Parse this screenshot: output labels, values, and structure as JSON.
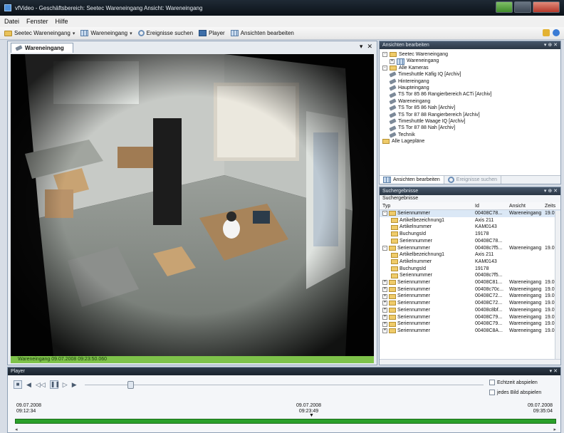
{
  "window": {
    "title": "vfVideo - Geschäftsbereich: Seetec Wareneingang Ansicht: Wareneingang"
  },
  "menu": [
    "Datei",
    "Fenster",
    "Hilfe"
  ],
  "toolbar": {
    "items": [
      {
        "label": "Seetec Wareneingang",
        "icon": "folder-icon"
      },
      {
        "label": "Wareneingang",
        "icon": "layout-grid-icon"
      },
      {
        "label": "Ereignisse suchen",
        "icon": "search-icon"
      },
      {
        "label": "Player",
        "icon": "player-icon"
      },
      {
        "label": "Ansichten bearbeiten",
        "icon": "layout-grid-icon"
      }
    ]
  },
  "document": {
    "tab": "Wareneingang",
    "status": "Wareneingang  09.07.2008 09:23:50.060"
  },
  "views_panel": {
    "title": "Ansichten bearbeiten",
    "tree": [
      {
        "level": 0,
        "expander": "-",
        "icon": "folder-icon",
        "label": "Seetec Wareneingang"
      },
      {
        "level": 1,
        "expander": "+",
        "icon": "layout-grid-icon",
        "label": "Wareneingang"
      },
      {
        "level": 0,
        "expander": "-",
        "icon": "folder-icon",
        "label": "Alle Kameras"
      },
      {
        "level": 1,
        "expander": "",
        "icon": "camera-icon",
        "label": "Timeshuttle Käfig IQ [Archiv]"
      },
      {
        "level": 1,
        "expander": "",
        "icon": "camera-icon",
        "label": "Hintereingang"
      },
      {
        "level": 1,
        "expander": "",
        "icon": "camera-icon",
        "label": "Haupteingang"
      },
      {
        "level": 1,
        "expander": "",
        "icon": "camera-icon",
        "label": "TS Tor 85 86 Rangierbereich ACTi [Archiv]"
      },
      {
        "level": 1,
        "expander": "",
        "icon": "camera-icon",
        "label": "Wareneingang"
      },
      {
        "level": 1,
        "expander": "",
        "icon": "camera-icon",
        "label": "TS Tor 85 86 Nah [Archiv]"
      },
      {
        "level": 1,
        "expander": "",
        "icon": "camera-icon",
        "label": "TS Tor 87 88 Rangierbereich [Archiv]"
      },
      {
        "level": 1,
        "expander": "",
        "icon": "camera-icon",
        "label": "Timeshuttle Waage IQ [Archiv]"
      },
      {
        "level": 1,
        "expander": "",
        "icon": "camera-icon",
        "label": "TS Tor 87 88 Nah [Archiv]"
      },
      {
        "level": 1,
        "expander": "",
        "icon": "camera-icon",
        "label": "Technik"
      },
      {
        "level": 0,
        "expander": "",
        "icon": "folder-icon",
        "label": "Alle Lagepläne"
      }
    ],
    "tabs": [
      {
        "label": "Ansichten bearbeiten",
        "active": true
      },
      {
        "label": "Ereignisse suchen",
        "active": false
      }
    ]
  },
  "results_panel": {
    "title": "Suchergebnisse",
    "subtitle": "Suchergebnisse",
    "columns": [
      "Typ",
      "Id",
      "Ansicht",
      "Zeits"
    ],
    "rows": [
      {
        "level": 0,
        "expander": "-",
        "typ": "Seriennummer",
        "id": "00408C78...",
        "ansicht": "Wareneingang",
        "zeit": "19.0",
        "selected": true
      },
      {
        "level": 1,
        "expander": "",
        "typ": "Artikelbezeichnung1",
        "id": "Axis 211",
        "ansicht": "",
        "zeit": ""
      },
      {
        "level": 1,
        "expander": "",
        "typ": "Artikelnummer",
        "id": "KAM0143",
        "ansicht": "",
        "zeit": ""
      },
      {
        "level": 1,
        "expander": "",
        "typ": "BuchungsId",
        "id": "19178",
        "ansicht": "",
        "zeit": ""
      },
      {
        "level": 1,
        "expander": "",
        "typ": "Seriennummer",
        "id": "00408C78...",
        "ansicht": "",
        "zeit": ""
      },
      {
        "level": 0,
        "expander": "-",
        "typ": "Seriennummer",
        "id": "00408c7f5...",
        "ansicht": "Wareneingang",
        "zeit": "19.0"
      },
      {
        "level": 1,
        "expander": "",
        "typ": "Artikelbezeichnung1",
        "id": "Axis 211",
        "ansicht": "",
        "zeit": ""
      },
      {
        "level": 1,
        "expander": "",
        "typ": "Artikelnummer",
        "id": "KAM0143",
        "ansicht": "",
        "zeit": ""
      },
      {
        "level": 1,
        "expander": "",
        "typ": "BuchungsId",
        "id": "19178",
        "ansicht": "",
        "zeit": ""
      },
      {
        "level": 1,
        "expander": "",
        "typ": "Seriennummer",
        "id": "00408c7f5...",
        "ansicht": "",
        "zeit": ""
      },
      {
        "level": 0,
        "expander": "+",
        "typ": "Seriennummer",
        "id": "00408C81...",
        "ansicht": "Wareneingang",
        "zeit": "19.0"
      },
      {
        "level": 0,
        "expander": "+",
        "typ": "Seriennummer",
        "id": "00408c70c...",
        "ansicht": "Wareneingang",
        "zeit": "19.0"
      },
      {
        "level": 0,
        "expander": "+",
        "typ": "Seriennummer",
        "id": "00408C72...",
        "ansicht": "Wareneingang",
        "zeit": "19.0"
      },
      {
        "level": 0,
        "expander": "+",
        "typ": "Seriennummer",
        "id": "00408C72...",
        "ansicht": "Wareneingang",
        "zeit": "19.0"
      },
      {
        "level": 0,
        "expander": "+",
        "typ": "Seriennummer",
        "id": "00408c8bf...",
        "ansicht": "Wareneingang",
        "zeit": "19.0"
      },
      {
        "level": 0,
        "expander": "+",
        "typ": "Seriennummer",
        "id": "00408C79...",
        "ansicht": "Wareneingang",
        "zeit": "19.0"
      },
      {
        "level": 0,
        "expander": "+",
        "typ": "Seriennummer",
        "id": "00408C79...",
        "ansicht": "Wareneingang",
        "zeit": "19.0"
      },
      {
        "level": 0,
        "expander": "+",
        "typ": "Seriennummer",
        "id": "00408C8A...",
        "ansicht": "Wareneingang",
        "zeit": "19.0"
      }
    ]
  },
  "player": {
    "title": "Player",
    "checkbox_realtime": "Echtzeit abspielen",
    "checkbox_every_frame": "jedes Bild abspielen",
    "time_start_date": "09.07.2008",
    "time_start_time": "09:12:34",
    "time_mid_date": "09.07.2008",
    "time_mid_time": "09:23:49",
    "time_end_date": "09.07.2008",
    "time_end_time": "09:35:04"
  },
  "colors": {
    "accent_green": "#2aa02a",
    "status_green": "#7ec24a",
    "panel_header": "#2a3644"
  }
}
